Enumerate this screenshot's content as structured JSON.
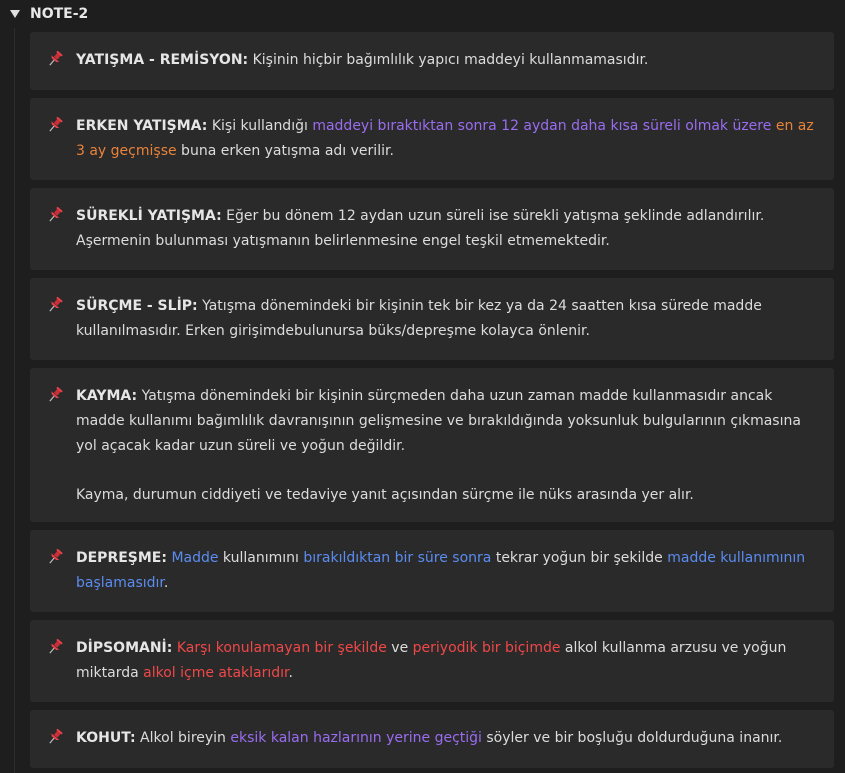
{
  "header": {
    "title": "NOTE-2"
  },
  "cards": [
    {
      "term": "YATIŞMA - REMİSYON",
      "colon": ":",
      "segments": [
        {
          "text": " Kişinin hiçbir bağımlılık yapıcı maddeyi kullanmamasıdır.",
          "color": "plain"
        }
      ]
    },
    {
      "term": "ERKEN YATIŞMA",
      "colon": ":",
      "segments": [
        {
          "text": " Kişi kullandığı ",
          "color": "plain"
        },
        {
          "text": "maddeyi bıraktıktan sonra 12 aydan daha kısa süreli olmak üzere",
          "color": "purple"
        },
        {
          "text": " ",
          "color": "plain"
        },
        {
          "text": "en az 3 ay geçmişse",
          "color": "orange"
        },
        {
          "text": " buna erken yatışma adı verilir.",
          "color": "plain"
        }
      ]
    },
    {
      "term": "SÜREKLİ YATIŞMA",
      "colon": ":",
      "segments": [
        {
          "text": " Eğer bu dönem 12 aydan uzun süreli ise sürekli yatışma şeklinde adlandırılır. Aşermenin bulunması yatışmanın belirlenmesine engel teşkil etmemektedir.",
          "color": "plain"
        }
      ]
    },
    {
      "term": "SÜRÇME - SLİP",
      "colon": ":",
      "segments": [
        {
          "text": " Yatışma dönemindeki bir kişinin tek bir kez ya da 24 saatten kısa sürede madde kullanılmasıdır. Erken girişimdebulunursa büks/depreşme kolayca önlenir.",
          "color": "plain"
        }
      ]
    },
    {
      "term": "KAYMA",
      "colon": ":",
      "segments": [
        {
          "text": " Yatışma dönemindeki bir kişinin sürçmeden daha uzun zaman madde kullanmasıdır ancak madde kullanımı bağımlılık davranışının gelişmesine ve bırakıldığında yoksunluk bulgularının çıkmasına yol açacak kadar uzun süreli ve yoğun değildir.",
          "color": "plain"
        }
      ],
      "extra_paragraph": "Kayma, durumun ciddiyeti ve tedaviye yanıt açısından sürçme ile nüks arasında yer alır."
    },
    {
      "term": "DEPREŞME",
      "colon": ":",
      "segments": [
        {
          "text": " ",
          "color": "plain"
        },
        {
          "text": "Madde",
          "color": "blue"
        },
        {
          "text": " kullanımını ",
          "color": "plain"
        },
        {
          "text": "bırakıldıktan bir süre sonra",
          "color": "blue"
        },
        {
          "text": " tekrar yoğun bir şekilde ",
          "color": "plain"
        },
        {
          "text": "madde kullanımının başlamasıdır",
          "color": "blue"
        },
        {
          "text": ".",
          "color": "plain"
        }
      ]
    },
    {
      "term": "DİPSOMANİ",
      "colon": ":",
      "segments": [
        {
          "text": " ",
          "color": "plain"
        },
        {
          "text": "Karşı konulamayan bir şekilde",
          "color": "red"
        },
        {
          "text": " ve ",
          "color": "plain"
        },
        {
          "text": "periyodik bir biçimde",
          "color": "red"
        },
        {
          "text": " alkol kullanma arzusu ve yoğun miktarda ",
          "color": "plain"
        },
        {
          "text": "alkol içme ataklarıdır",
          "color": "red"
        },
        {
          "text": ".",
          "color": "plain"
        }
      ]
    },
    {
      "term": "KOHUT",
      "colon": ":",
      "segments": [
        {
          "text": " Alkol bireyin ",
          "color": "plain"
        },
        {
          "text": "eksik kalan hazlarının yerine geçtiği",
          "color": "purple"
        },
        {
          "text": " söyler ve bir boşluğu doldurduğuna inanır.",
          "color": "plain"
        }
      ]
    }
  ],
  "icons": {
    "pin": "pushpin-icon",
    "toggle": "triangle-down-icon"
  },
  "colors": {
    "background": "#1e1e1e",
    "card": "#2a2a2a",
    "text": "#dcdcdc",
    "purple": "#9a6cf0",
    "orange": "#e8833a",
    "blue": "#5b8cf0",
    "red": "#f04848",
    "pin": "#e8414a"
  }
}
